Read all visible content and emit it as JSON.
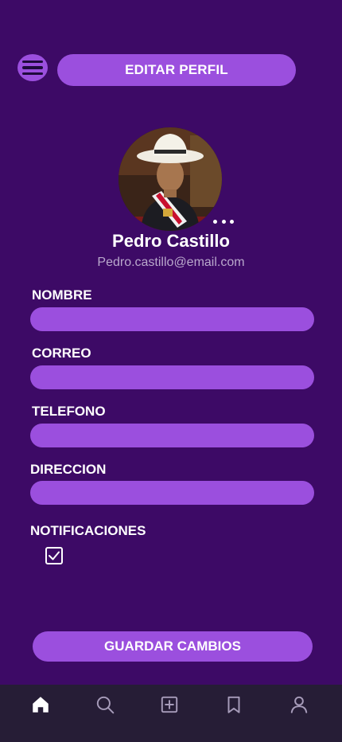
{
  "header": {
    "menu_icon": "hamburger-menu-icon",
    "title": "EDITAR PERFIL"
  },
  "profile": {
    "avatar": "profile-photo",
    "more_icon": "more-options-icon",
    "name": "Pedro Castillo",
    "email": "Pedro.castillo@email.com"
  },
  "form": {
    "nombre_label": "NOMBRE",
    "nombre_value": "",
    "correo_label": "CORREO",
    "correo_value": "",
    "telefono_label": "TELEFONO",
    "telefono_value": "",
    "direccion_label": "DIRECCION",
    "direccion_value": "",
    "notificaciones_label": "NOTIFICACIONES",
    "notificaciones_checked": true
  },
  "actions": {
    "save_label": "GUARDAR CAMBIOS"
  },
  "bottom_nav": {
    "items": [
      {
        "icon": "home-icon",
        "active": true
      },
      {
        "icon": "search-icon",
        "active": false
      },
      {
        "icon": "add-square-icon",
        "active": false
      },
      {
        "icon": "bookmark-icon",
        "active": false
      },
      {
        "icon": "user-icon",
        "active": false
      }
    ]
  },
  "colors": {
    "background": "#3d0a66",
    "accent": "#9b4fde",
    "nav_background": "#261d36",
    "text": "#ffffff",
    "muted_text": "#b9a8cc"
  }
}
